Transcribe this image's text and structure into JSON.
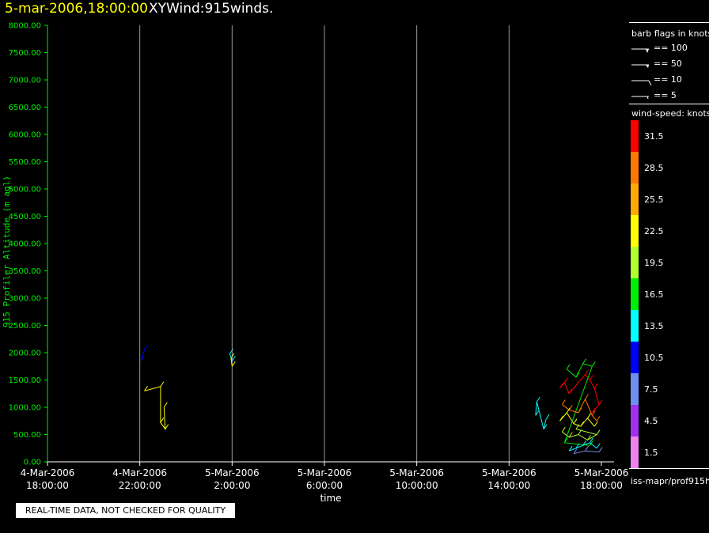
{
  "header": {
    "date_time": "5-mar-2006,18:00:00",
    "title": "XYWind:915winds."
  },
  "legend": {
    "barb_title": "barb flags in knots",
    "barbs": [
      {
        "label": "== 100"
      },
      {
        "label": "== 50"
      },
      {
        "label": "== 10"
      },
      {
        "label": "== 5"
      }
    ],
    "speed_title": "wind-speed: knots",
    "speed_bins": [
      {
        "label": "31.5",
        "color": "#ff0000"
      },
      {
        "label": "28.5",
        "color": "#ff7700"
      },
      {
        "label": "25.5",
        "color": "#ffaa00"
      },
      {
        "label": "22.5",
        "color": "#ffff00"
      },
      {
        "label": "19.5",
        "color": "#b0ff30"
      },
      {
        "label": "16.5",
        "color": "#00ee00"
      },
      {
        "label": "13.5",
        "color": "#00ffff"
      },
      {
        "label": "10.5",
        "color": "#0000ff"
      },
      {
        "label": "7.5",
        "color": "#6f8ff0"
      },
      {
        "label": "4.5",
        "color": "#a030f0"
      },
      {
        "label": "1.5",
        "color": "#ee82ee"
      }
    ]
  },
  "source_label": "iss-mapr/prof915h",
  "quality_note": "REAL-TIME DATA, NOT CHECKED FOR QUALITY",
  "chart_data": {
    "type": "scatter",
    "title": "XYWind:915winds.",
    "xlabel": "time",
    "ylabel": "915 Profiler Altitude (m agl)",
    "ylim": [
      0,
      8000
    ],
    "xlim_hours": [
      0,
      24
    ],
    "yticks": [
      "0.00",
      "500.00",
      "1000.00",
      "1500.00",
      "2000.00",
      "2500.00",
      "3000.00",
      "3500.00",
      "4000.00",
      "4500.00",
      "5000.00",
      "5500.00",
      "6000.00",
      "6500.00",
      "7000.00",
      "7500.00",
      "8000.00"
    ],
    "xticks": [
      {
        "hour": 0,
        "date": "4-Mar-2006",
        "time": "18:00:00"
      },
      {
        "hour": 4,
        "date": "4-Mar-2006",
        "time": "22:00:00"
      },
      {
        "hour": 8,
        "date": "5-Mar-2006",
        "time": "2:00:00"
      },
      {
        "hour": 12,
        "date": "5-Mar-2006",
        "time": "6:00:00"
      },
      {
        "hour": 16,
        "date": "5-Mar-2006",
        "time": "10:00:00"
      },
      {
        "hour": 20,
        "date": "5-Mar-2006",
        "time": "14:00:00"
      },
      {
        "hour": 24,
        "date": "5-Mar-2006",
        "time": "18:00:00"
      }
    ],
    "grid_x": true,
    "grid_y": false,
    "axis_color": "#00ee00",
    "series": [
      {
        "color": "#0000ff",
        "points": [
          [
            4.05,
            1850
          ],
          [
            4.2,
            2050
          ]
        ]
      },
      {
        "color": "#ffff00",
        "points": [
          [
            4.2,
            1300
          ],
          [
            4.9,
            1380
          ],
          [
            4.9,
            720
          ],
          [
            5.1,
            600
          ],
          [
            5.05,
            1000
          ]
        ]
      },
      {
        "color": "#00ffff",
        "points": [
          [
            7.9,
            1980
          ],
          [
            8.0,
            1850
          ]
        ]
      },
      {
        "color": "#ffff00",
        "points": [
          [
            7.95,
            1900
          ],
          [
            8.0,
            1750
          ]
        ]
      },
      {
        "color": "#00ffff",
        "points": [
          [
            21.15,
            850
          ],
          [
            21.2,
            1100
          ],
          [
            21.5,
            600
          ],
          [
            21.6,
            780
          ]
        ]
      },
      {
        "color": "#ff0000",
        "points": [
          [
            22.2,
            1350
          ],
          [
            22.4,
            1450
          ],
          [
            22.6,
            1250
          ],
          [
            23.3,
            1600
          ],
          [
            23.5,
            1500
          ],
          [
            23.7,
            1350
          ],
          [
            23.9,
            1050
          ],
          [
            23.6,
            900
          ]
        ]
      },
      {
        "color": "#ff7700",
        "points": [
          [
            22.3,
            1050
          ],
          [
            22.6,
            950
          ],
          [
            23.0,
            900
          ],
          [
            23.3,
            1150
          ],
          [
            23.6,
            850
          ],
          [
            23.8,
            750
          ]
        ]
      },
      {
        "color": "#ffff00",
        "points": [
          [
            22.2,
            750
          ],
          [
            22.5,
            900
          ],
          [
            22.8,
            700
          ],
          [
            23.1,
            650
          ],
          [
            23.4,
            800
          ],
          [
            23.7,
            650
          ]
        ]
      },
      {
        "color": "#b0ff30",
        "points": [
          [
            22.3,
            550
          ],
          [
            22.6,
            450
          ],
          [
            23.0,
            500
          ],
          [
            23.4,
            400
          ],
          [
            23.8,
            500
          ],
          [
            22.9,
            600
          ]
        ]
      },
      {
        "color": "#00ee00",
        "points": [
          [
            22.5,
            1700
          ],
          [
            22.9,
            1550
          ],
          [
            23.2,
            1800
          ],
          [
            23.6,
            1750
          ],
          [
            22.4,
            350
          ],
          [
            23.5,
            300
          ]
        ]
      },
      {
        "color": "#00ffff",
        "points": [
          [
            22.6,
            200
          ],
          [
            22.9,
            250
          ],
          [
            23.2,
            300
          ],
          [
            23.5,
            350
          ],
          [
            23.8,
            250
          ]
        ]
      },
      {
        "color": "#6f8ff0",
        "points": [
          [
            22.8,
            150
          ],
          [
            23.3,
            200
          ],
          [
            23.9,
            180
          ]
        ]
      }
    ]
  }
}
